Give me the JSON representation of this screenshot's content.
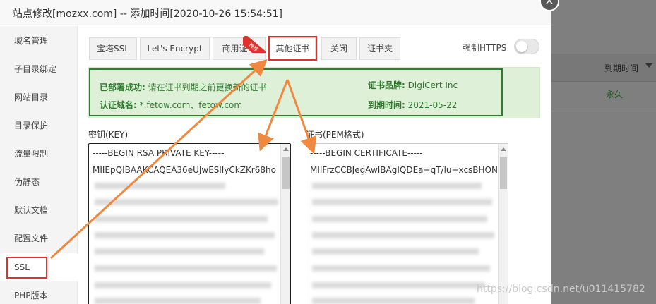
{
  "background": {
    "column_header": "到期时间",
    "cell_value": "永久"
  },
  "dialog": {
    "title": "站点修改[mozxx.com] -- 添加时间[2020-10-26 15:54:51]",
    "close_glyph": "×"
  },
  "sidebar": {
    "items": [
      {
        "label": "域名管理"
      },
      {
        "label": "子目录绑定"
      },
      {
        "label": "网站目录"
      },
      {
        "label": "目录保护"
      },
      {
        "label": "流量限制"
      },
      {
        "label": "伪静态"
      },
      {
        "label": "默认文档"
      },
      {
        "label": "配置文件"
      },
      {
        "label": "SSL"
      },
      {
        "label": "PHP版本"
      }
    ],
    "active": "SSL"
  },
  "tabs": [
    {
      "label": "宝塔SSL"
    },
    {
      "label": "Let's Encrypt"
    },
    {
      "label": "商用证书"
    },
    {
      "label": "其他证书"
    },
    {
      "label": "关闭"
    },
    {
      "label": "证书夹"
    }
  ],
  "active_tab": "其他证书",
  "badge_text": "推荐",
  "force_https": {
    "label": "强制HTTPS",
    "enabled": false
  },
  "status": {
    "deployed_label": "已部署成功:",
    "deployed_text": "请在证书到期之前更换新的证书",
    "domain_label": "认证域名:",
    "domain_value": "*.fetow.com、fetow.com",
    "brand_label": "证书品牌:",
    "brand_value": "DigiCert Inc",
    "expire_label": "到期时间:",
    "expire_value": "2021-05-22"
  },
  "key_field": {
    "label": "密钥(KEY)",
    "line1": "-----BEGIN RSA PRIVATE KEY-----",
    "line2": "MIIEpQIBAAKCAQEA36eUJwESlIyCkZKr68ho"
  },
  "cert_field": {
    "label": "证书(PEM格式)",
    "line1": "-----BEGIN CERTIFICATE-----",
    "line2": "MIIFrzCCBJegAwIBAgIQDEa+qT/lu+xcsBHON"
  },
  "watermark": "https://blog.csdn.net/u011415782",
  "colors": {
    "highlight_red": "#e0322d",
    "arrow_orange": "#f0883e",
    "success_green": "#2f7a2f",
    "panel_green": "#dff0d8"
  }
}
